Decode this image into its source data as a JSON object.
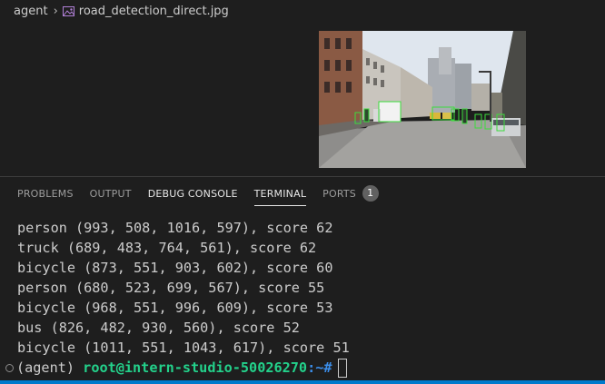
{
  "breadcrumb": {
    "folder": "agent",
    "file": "road_detection_direct.jpg"
  },
  "panel": {
    "tabs": [
      {
        "label": "PROBLEMS"
      },
      {
        "label": "OUTPUT"
      },
      {
        "label": "DEBUG CONSOLE"
      },
      {
        "label": "TERMINAL"
      },
      {
        "label": "PORTS"
      }
    ],
    "ports_badge": "1",
    "active_tab": "TERMINAL"
  },
  "terminal": {
    "lines": [
      "person (993, 508, 1016, 597), score 62",
      "truck (689, 483, 764, 561), score 62",
      "bicycle (873, 551, 903, 602), score 60",
      "person (680, 523, 699, 567), score 55",
      "bicycle (968, 551, 996, 609), score 53",
      "bus (826, 482, 930, 560), score 52",
      "bicycle (1011, 551, 1043, 617), score 51"
    ],
    "prompt": {
      "env": "(agent)",
      "user_host": "root@intern-studio-50026270",
      "path": ":~#"
    }
  },
  "colors": {
    "background": "#1e1e1e",
    "prompt_green": "#23d18b",
    "status_bar": "#007acc",
    "detection_box": "#3cdc3c"
  }
}
